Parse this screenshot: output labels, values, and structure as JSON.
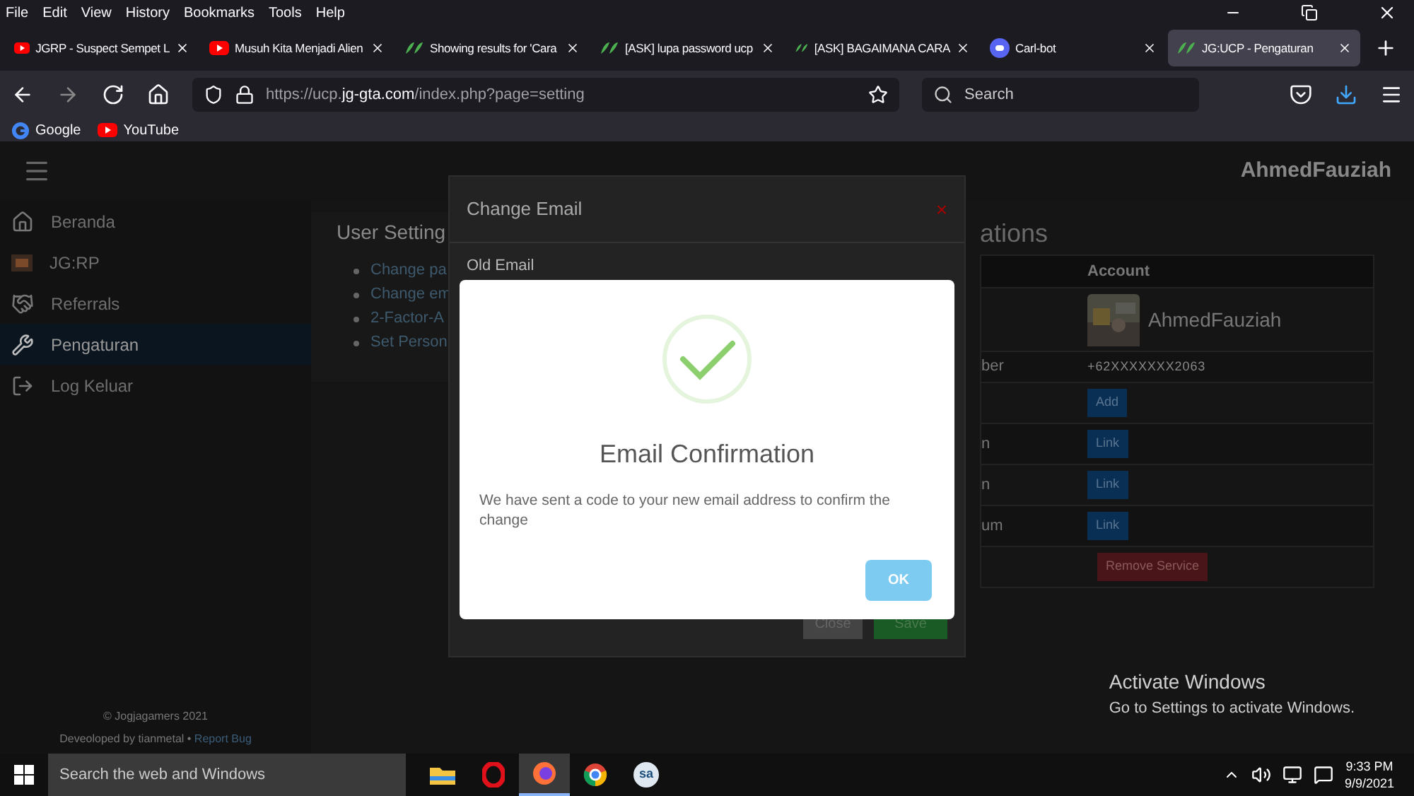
{
  "menubar": [
    "File",
    "Edit",
    "View",
    "History",
    "Bookmarks",
    "Tools",
    "Help"
  ],
  "tabs": [
    {
      "label": "JGRP - Suspect Sempet L",
      "kind": "video",
      "selected": false
    },
    {
      "label": "Musuh Kita Menjadi Alien",
      "kind": "video",
      "selected": false
    },
    {
      "label": "Showing results for 'Cara",
      "kind": "forum",
      "selected": false
    },
    {
      "label": "[ASK] lupa password ucp",
      "kind": "forum",
      "selected": false
    },
    {
      "label": "[ASK] BAGAIMANA CARA",
      "kind": "forum",
      "selected": false
    },
    {
      "label": "Carl-bot",
      "kind": "chat",
      "selected": false
    },
    {
      "label": "JG:UCP - Pengaturan",
      "kind": "forum",
      "selected": true
    }
  ],
  "address": {
    "prefix": "https://ucp.",
    "domain": "jg-gta.com",
    "path": "/index.php?page=setting"
  },
  "search": {
    "placeholder": "Search"
  },
  "bookmarks": [
    {
      "label": "Google",
      "kind": "search"
    },
    {
      "label": "YouTube",
      "kind": "video"
    }
  ],
  "site": {
    "username": "AhmedFauziah",
    "sidebar": [
      {
        "label": "Beranda",
        "kind": "home",
        "selected": false
      },
      {
        "label": "JG:RP",
        "kind": "game",
        "selected": false
      },
      {
        "label": "Referrals",
        "kind": "referral",
        "selected": false
      },
      {
        "label": "Pengaturan",
        "kind": "settings",
        "selected": true
      },
      {
        "label": "Log Keluar",
        "kind": "logout",
        "selected": false
      }
    ],
    "footer": {
      "copyright": "© Jogjagamers 2021",
      "credit": "Deveoloped by tianmetal •",
      "link": "Report Bug"
    },
    "settings": {
      "title": "User Setting",
      "items": [
        "Change pa",
        "Change em",
        "2-Factor-A",
        "Set Person"
      ]
    },
    "associations": {
      "title": "ations",
      "header": "Account",
      "rows": [
        {
          "label": "",
          "kind": "profile",
          "value": "AhmedFauziah"
        },
        {
          "label": "ber",
          "kind": "text",
          "value": "+62XXXXXXX2063"
        },
        {
          "label": "",
          "kind": "button",
          "value": "Add"
        },
        {
          "label": "n",
          "kind": "button",
          "value": "Link"
        },
        {
          "label": "n",
          "kind": "button",
          "value": "Link"
        },
        {
          "label": "um",
          "kind": "button",
          "value": "Link"
        },
        {
          "label": "",
          "kind": "danger",
          "value": "Remove Service"
        }
      ]
    }
  },
  "modal": {
    "title": "Change Email",
    "close": "×",
    "field_label": "Old Email",
    "buttons": [
      "Close",
      "Save"
    ]
  },
  "alert": {
    "title": "Email Confirmation",
    "message": "We have sent a code to your new email address to confirm the change",
    "button": "OK"
  },
  "watermark_os": {
    "title": "Activate Windows",
    "subtitle": "Go to Settings to activate Windows."
  },
  "taskbar": {
    "search_placeholder": "Search the web and Windows",
    "apps": [
      {
        "kind": "files",
        "selected": false
      },
      {
        "kind": "browser1",
        "selected": false
      },
      {
        "kind": "browser2",
        "selected": true
      },
      {
        "kind": "browser3",
        "selected": false
      },
      {
        "kind": "chat",
        "label": "sa",
        "selected": false
      }
    ],
    "time": "9:33 PM",
    "date": "9/9/2021"
  }
}
